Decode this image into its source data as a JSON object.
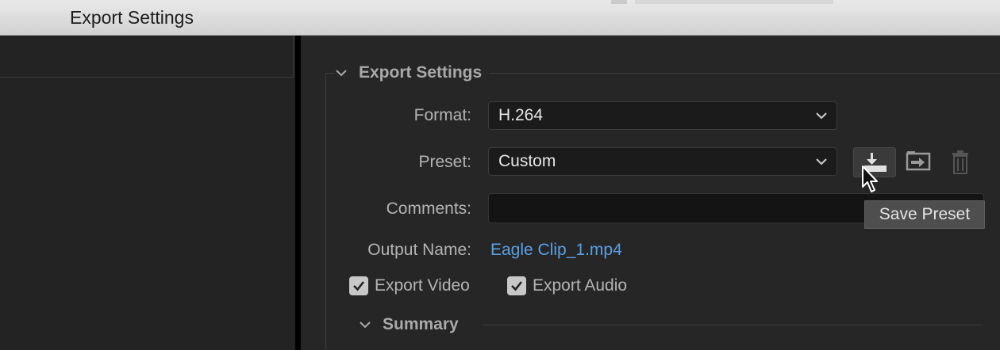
{
  "window": {
    "title": "Export Settings"
  },
  "export_settings": {
    "section_label": "Export Settings",
    "format": {
      "label": "Format:",
      "value": "H.264"
    },
    "preset": {
      "label": "Preset:",
      "value": "Custom"
    },
    "comments": {
      "label": "Comments:",
      "value": ""
    },
    "output_name": {
      "label": "Output Name:",
      "value": "Eagle Clip_1.mp4"
    },
    "export_video": {
      "label": "Export Video",
      "checked": true
    },
    "export_audio": {
      "label": "Export Audio",
      "checked": true
    },
    "summary": {
      "label": "Summary"
    }
  },
  "preset_actions": {
    "save_icon": "save-preset-icon",
    "import_icon": "import-preset-icon",
    "delete_icon": "delete-preset-icon",
    "tooltip": "Save Preset"
  },
  "colors": {
    "link": "#5aa0e6",
    "panel_bg": "#262626",
    "title_bar": "#dcdcdc"
  }
}
